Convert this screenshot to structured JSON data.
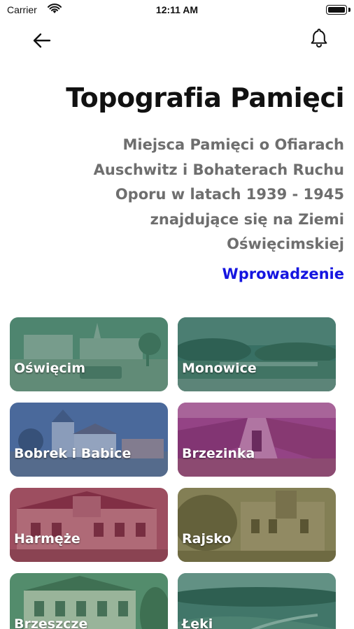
{
  "status_bar": {
    "carrier": "Carrier",
    "time": "12:11 AM"
  },
  "header": {
    "back_icon": "arrow-left-icon",
    "notification_icon": "bell-icon"
  },
  "main": {
    "title": "Topografia Pamięci",
    "subtitle_lines": [
      "Miejsca Pamięci o Ofiarach",
      "Auschwitz i Bohaterach Ruchu",
      "Oporu w latach 1939 - 1945",
      "znajdujące się na Ziemi",
      "Oświęcimskiej"
    ],
    "intro_link": "Wprowadzenie",
    "link_color": "#1515e0"
  },
  "places": [
    {
      "label": "Oświęcim",
      "tint": "#3f7a63"
    },
    {
      "label": "Monowice",
      "tint": "#2f6a5c"
    },
    {
      "label": "Bobrek i Babice",
      "tint": "#2f4f86"
    },
    {
      "label": "Brzezinka",
      "tint": "#8a2f78"
    },
    {
      "label": "Harmęże",
      "tint": "#8a2f46"
    },
    {
      "label": "Rajsko",
      "tint": "#6f6a3a"
    },
    {
      "label": "Brzeszcze",
      "tint": "#3f7a56"
    },
    {
      "label": "Łęki",
      "tint": "#2f6a5c"
    }
  ]
}
